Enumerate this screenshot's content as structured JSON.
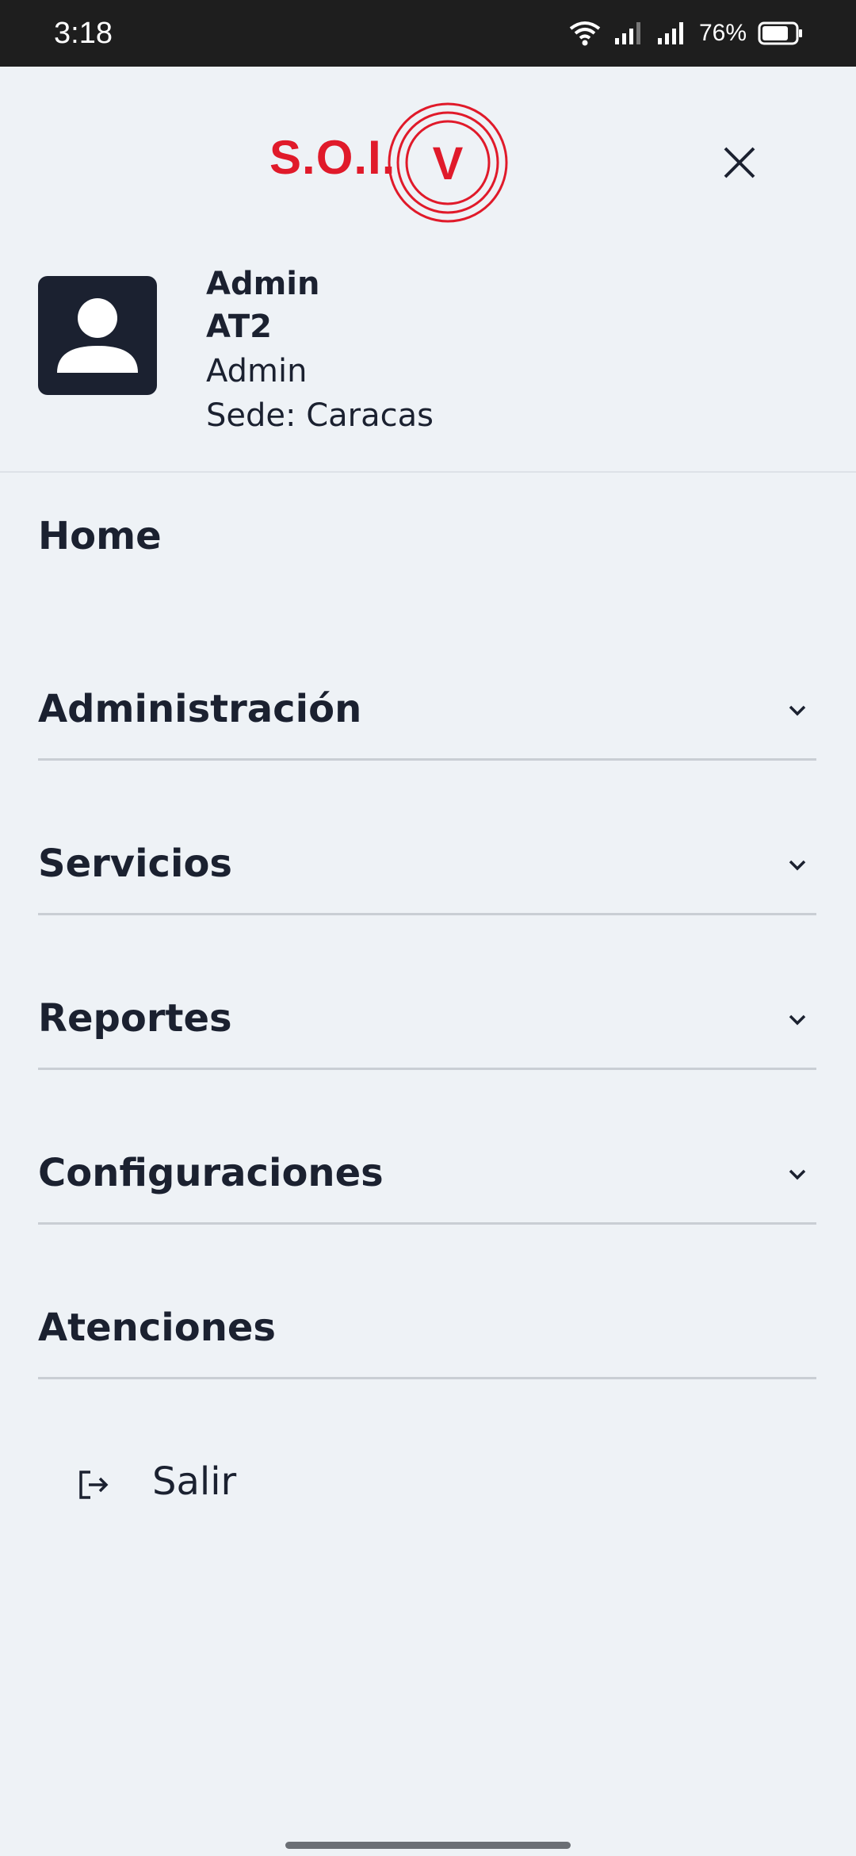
{
  "status_bar": {
    "time": "3:18",
    "battery": "76%"
  },
  "header": {
    "logo_text": "S.O.I.",
    "logo_mark": "V",
    "brand_color": "#e01a2a"
  },
  "profile": {
    "name": "Admin",
    "code": "AT2",
    "role": "Admin",
    "sede": "Sede: Caracas"
  },
  "menu": {
    "items": [
      {
        "label": "Home",
        "icon": "none",
        "expandable": false
      },
      {
        "label": "Administración",
        "icon": "chevron-down-icon",
        "expandable": true
      },
      {
        "label": "Servicios",
        "icon": "chevron-down-icon",
        "expandable": true
      },
      {
        "label": "Reportes",
        "icon": "chevron-down-icon",
        "expandable": true
      },
      {
        "label": "Configuraciones",
        "icon": "chevron-down-icon",
        "expandable": true
      },
      {
        "label": "Atenciones",
        "icon": "none",
        "expandable": false
      }
    ],
    "logout_label": "Salir"
  }
}
